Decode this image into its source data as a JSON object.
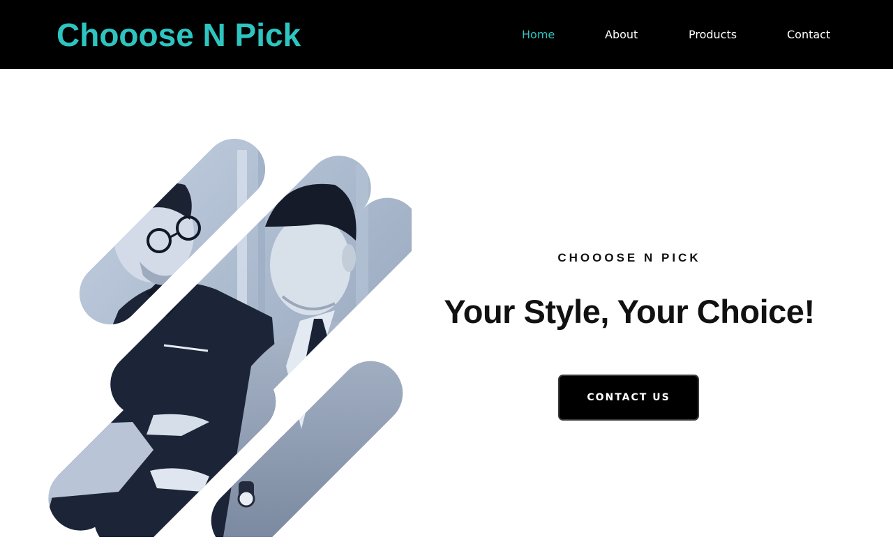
{
  "header": {
    "brand": "Chooose N Pick",
    "nav": [
      {
        "label": "Home",
        "active": true
      },
      {
        "label": "About",
        "active": false
      },
      {
        "label": "Products",
        "active": false
      },
      {
        "label": "Contact",
        "active": false
      }
    ]
  },
  "hero": {
    "eyebrow": "CHOOOSE N PICK",
    "headline": "Your Style, Your Choice!",
    "cta_label": "CONTACT US",
    "image_icon": "two-businessmen-photo-collage"
  },
  "colors": {
    "accent": "#2ec4c0",
    "nav_background": "#000000",
    "text": "#111111",
    "button_background": "#000000"
  }
}
